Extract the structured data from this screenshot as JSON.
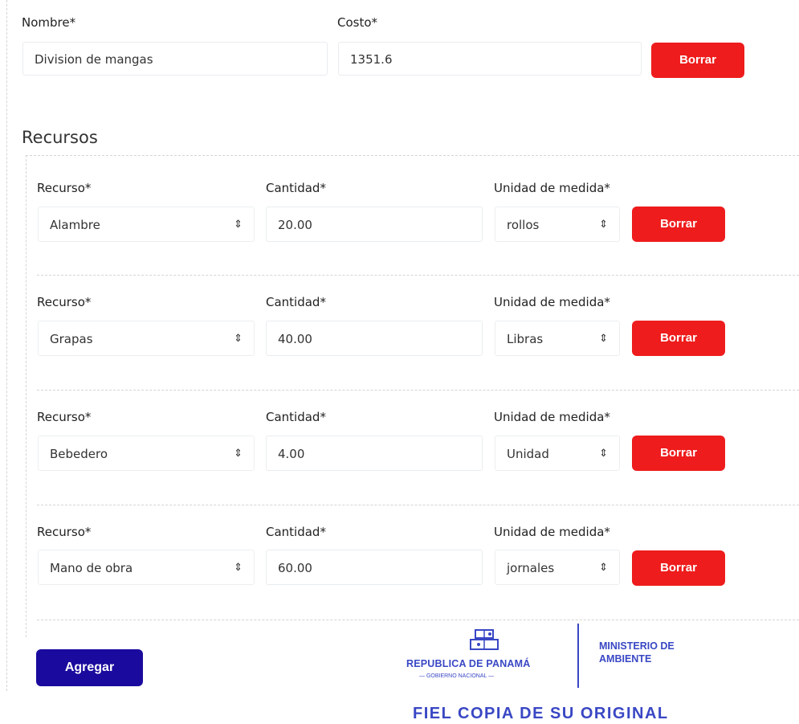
{
  "activity": {
    "name_label": "Nombre*",
    "name_value": "Division de mangas",
    "cost_label": "Costo*",
    "cost_value": "1351.6",
    "delete_label": "Borrar"
  },
  "resources": {
    "title": "Recursos",
    "resource_label": "Recurso*",
    "quantity_label": "Cantidad*",
    "unit_label": "Unidad de medida*",
    "delete_label": "Borrar",
    "items": [
      {
        "resource": "Alambre",
        "quantity": "20.00",
        "unit": "rollos"
      },
      {
        "resource": "Grapas",
        "quantity": "40.00",
        "unit": "Libras"
      },
      {
        "resource": "Bebedero",
        "quantity": "4.00",
        "unit": "Unidad"
      },
      {
        "resource": "Mano de obra",
        "quantity": "60.00",
        "unit": "jornales"
      }
    ],
    "add_label": "Agregar"
  },
  "stamp": {
    "republic": "REPUBLICA DE PANAMÁ",
    "gobierno": "— GOBIERNO NACIONAL —",
    "ministry_line1": "MINISTERIO DE",
    "ministry_line2": "AMBIENTE",
    "certification": "FIEL COPIA DE SU ORIGINAL"
  },
  "colors": {
    "delete_button": "#ee1c1c",
    "add_button": "#1a0a9e",
    "stamp_ink": "#3947c4"
  }
}
